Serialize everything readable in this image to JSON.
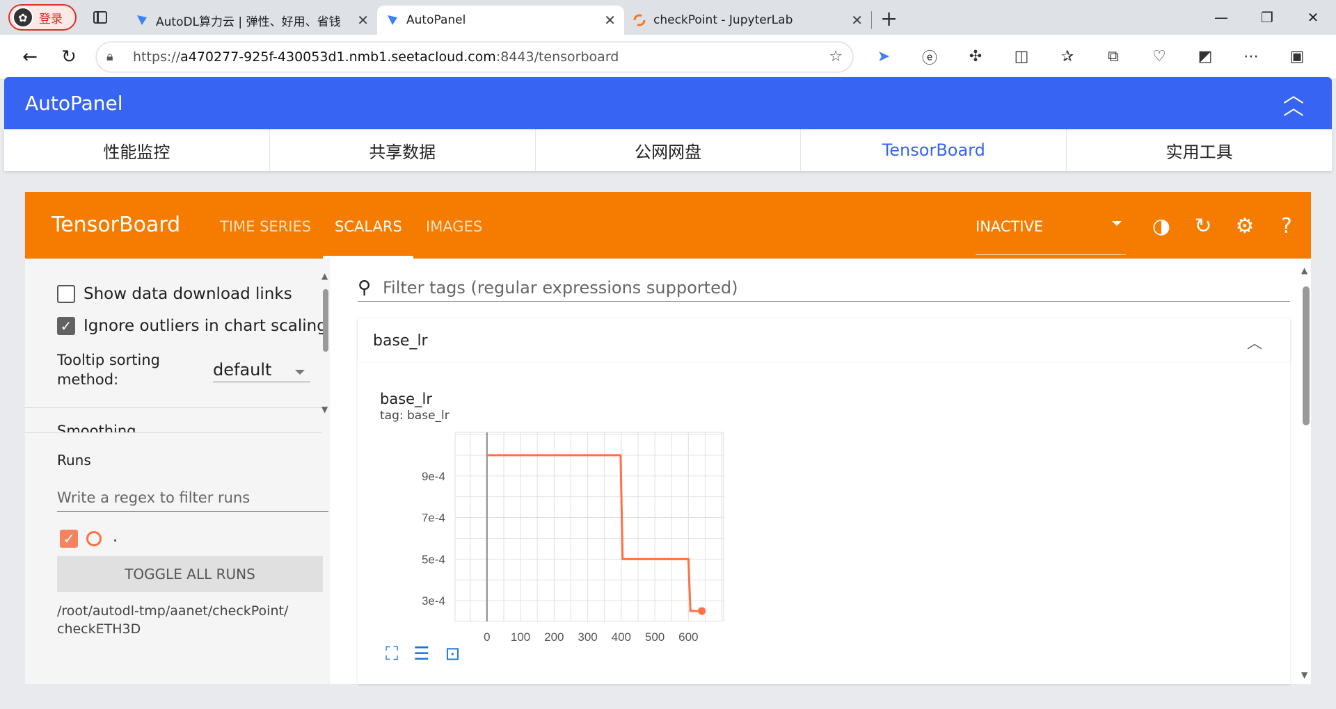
{
  "browser": {
    "profile_label": "登录",
    "tabs": [
      {
        "title": "AutoDL算力云 | 弹性、好用、省钱"
      },
      {
        "title": "AutoPanel"
      },
      {
        "title": "checkPoint - JupyterLab"
      }
    ],
    "url_prefix": "https://",
    "url_host": "a470277-925f-430053d1.nmb1.seetacloud.com",
    "url_rest": ":8443/tensorboard"
  },
  "autopanel": {
    "title": "AutoPanel",
    "nav": [
      "性能监控",
      "共享数据",
      "公网网盘",
      "TensorBoard",
      "实用工具"
    ],
    "active_nav": "TensorBoard"
  },
  "tensorboard": {
    "logo": "TensorBoard",
    "tabs": [
      "TIME SERIES",
      "SCALARS",
      "IMAGES"
    ],
    "active_tab": "SCALARS",
    "status": "INACTIVE",
    "accent_color": "#f57c00"
  },
  "sidebar": {
    "show_download_label": "Show data download links",
    "show_download_checked": false,
    "ignore_outliers_label": "Ignore outliers in chart scaling",
    "ignore_outliers_checked": true,
    "tooltip_label_1": "Tooltip sorting",
    "tooltip_label_2": "method:",
    "tooltip_value": "default",
    "smoothing_label": "Smoothing",
    "runs_label": "Runs",
    "runs_filter_placeholder": "Write a regex to filter runs",
    "run_name": ".",
    "toggle_label": "TOGGLE ALL RUNS",
    "logdir_line1": "/root/autodl-tmp/aanet/checkPoint/",
    "logdir_line2": "checkETH3D"
  },
  "main": {
    "filter_placeholder": "Filter tags (regular expressions supported)",
    "card_title": "base_lr",
    "chart_title": "base_lr",
    "chart_tag": "tag: base_lr"
  },
  "chart_data": {
    "type": "line",
    "title": "base_lr",
    "x_ticks": [
      0,
      100,
      200,
      300,
      400,
      500,
      600
    ],
    "y_ticks": [
      "3e-4",
      "5e-4",
      "7e-4",
      "9e-4"
    ],
    "y_tick_values": [
      0.0003,
      0.0005,
      0.0007,
      0.0009
    ],
    "xlim": [
      -95,
      705
    ],
    "ylim": [
      0.0002,
      0.00111
    ],
    "series": [
      {
        "color": "#ff7043",
        "x": [
          0,
          398,
          404,
          600,
          606,
          640
        ],
        "y": [
          0.001,
          0.001,
          0.0005,
          0.0005,
          0.00025,
          0.00025
        ]
      }
    ]
  }
}
